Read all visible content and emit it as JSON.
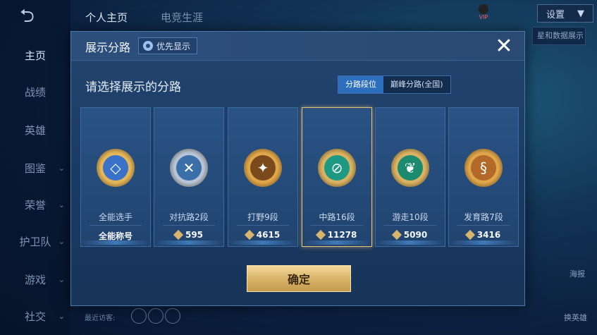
{
  "background": {
    "back_icon": "back-arrow-icon",
    "tabs": [
      "个人主页",
      "电竞生涯"
    ],
    "nav": [
      {
        "label": "主页",
        "active": true,
        "arrow": false
      },
      {
        "label": "战绩",
        "active": false,
        "arrow": false
      },
      {
        "label": "英雄",
        "active": false,
        "arrow": false
      },
      {
        "label": "图鉴",
        "active": false,
        "arrow": true
      },
      {
        "label": "荣誉",
        "active": false,
        "arrow": true
      },
      {
        "label": "护卫队",
        "active": false,
        "arrow": true
      },
      {
        "label": "游戏",
        "active": false,
        "arrow": true
      },
      {
        "label": "社交",
        "active": false,
        "arrow": true
      }
    ],
    "vip": "VIP",
    "settings": "设置",
    "right_pill": "星和数据展示",
    "poster_label": "海报",
    "switch_hero_label": "换英雄",
    "recent_visitors": "最近访客:"
  },
  "modal": {
    "title": "展示分路",
    "priority_label": "优先显示",
    "close_icon": "close-icon",
    "subtitle": "请选择展示的分路",
    "segments": [
      {
        "label": "分路段位",
        "active": true
      },
      {
        "label": "巅峰分路(全国)",
        "active": false
      }
    ],
    "cards": [
      {
        "name": "全能选手",
        "value": "全能称号",
        "gem": false,
        "selected": false,
        "ring": "#e3b65a",
        "core": "#3a72c9",
        "glyph": "◇"
      },
      {
        "name": "对抗路2段",
        "value": "595",
        "gem": true,
        "selected": false,
        "ring": "#b6c4d6",
        "core": "#3b6fa8",
        "glyph": "✕"
      },
      {
        "name": "打野9段",
        "value": "4615",
        "gem": true,
        "selected": false,
        "ring": "#e0a64a",
        "core": "#7a4a1c",
        "glyph": "✦"
      },
      {
        "name": "中路16段",
        "value": "11278",
        "gem": true,
        "selected": true,
        "ring": "#d9b262",
        "core": "#1e9a84",
        "glyph": "⊘"
      },
      {
        "name": "游走10段",
        "value": "5090",
        "gem": true,
        "selected": false,
        "ring": "#d9b262",
        "core": "#1c8a6e",
        "glyph": "❦"
      },
      {
        "name": "发育路7段",
        "value": "3416",
        "gem": true,
        "selected": false,
        "ring": "#e0a64a",
        "core": "#b2692a",
        "glyph": "§"
      }
    ],
    "confirm_label": "确定"
  }
}
